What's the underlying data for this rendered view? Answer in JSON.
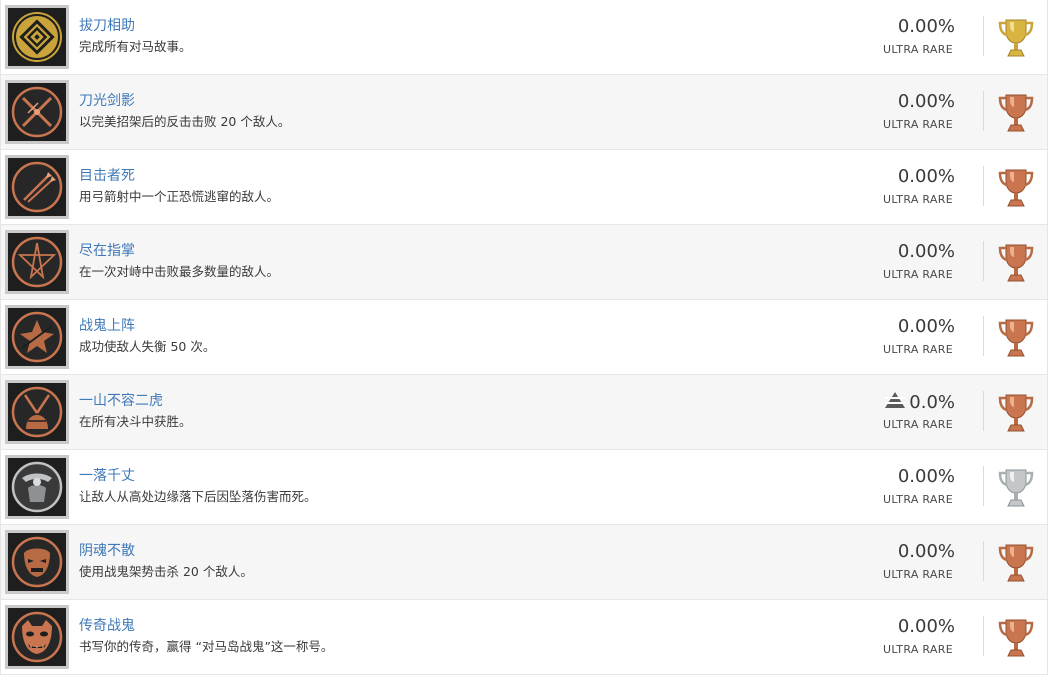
{
  "trophies": [
    {
      "title": "拔刀相助",
      "desc": "完成所有对马故事。",
      "percent": "0.00%",
      "rarity": "ULTRA RARE",
      "grade": "gold",
      "icon": "gold-seal-icon",
      "trend_up": false
    },
    {
      "title": "刀光剑影",
      "desc": "以完美招架后的反击击败 20 个敌人。",
      "percent": "0.00%",
      "rarity": "ULTRA RARE",
      "grade": "bronze",
      "icon": "crossed-swords-icon",
      "trend_up": false
    },
    {
      "title": "目击者死",
      "desc": "用弓箭射中一个正恐慌逃窜的敌人。",
      "percent": "0.00%",
      "rarity": "ULTRA RARE",
      "grade": "bronze",
      "icon": "arrows-icon",
      "trend_up": false
    },
    {
      "title": "尽在指掌",
      "desc": "在一次对峙中击败最多数量的敌人。",
      "percent": "0.00%",
      "rarity": "ULTRA RARE",
      "grade": "bronze",
      "icon": "star-slash-icon",
      "trend_up": false
    },
    {
      "title": "战鬼上阵",
      "desc": "成功使敌人失衡 50 次。",
      "percent": "0.00%",
      "rarity": "ULTRA RARE",
      "grade": "bronze",
      "icon": "shatter-icon",
      "trend_up": false
    },
    {
      "title": "一山不容二虎",
      "desc": "在所有决斗中获胜。",
      "percent": "0.0%",
      "rarity": "ULTRA RARE",
      "grade": "bronze",
      "icon": "duel-icon",
      "trend_up": true
    },
    {
      "title": "一落千丈",
      "desc": "让敌人从高处边缘落下后因坠落伤害而死。",
      "percent": "0.00%",
      "rarity": "ULTRA RARE",
      "grade": "silver",
      "icon": "falling-warrior-icon",
      "trend_up": false
    },
    {
      "title": "阴魂不散",
      "desc": "使用战鬼架势击杀 20 个敌人。",
      "percent": "0.00%",
      "rarity": "ULTRA RARE",
      "grade": "bronze",
      "icon": "ghost-mask-icon",
      "trend_up": false
    },
    {
      "title": "传奇战鬼",
      "desc": "书写你的传奇，赢得 “对马岛战鬼”这一称号。",
      "percent": "0.00%",
      "rarity": "ULTRA RARE",
      "grade": "bronze",
      "icon": "oni-mask-icon",
      "trend_up": false
    }
  ],
  "colors": {
    "title_link": "#3f79b8",
    "gold": "#d8b441",
    "silver": "#bfc3c6",
    "bronze": "#c9754f",
    "icon_bg": "#1f1f1f"
  }
}
